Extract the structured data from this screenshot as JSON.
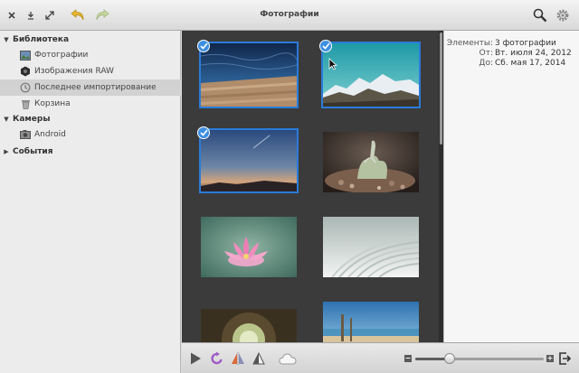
{
  "window": {
    "title": "Фотографии"
  },
  "sidebar": {
    "library": {
      "label": "Библиотека",
      "items": [
        {
          "label": "Фотографии"
        },
        {
          "label": "Изображения RAW"
        },
        {
          "label": "Последнее импортирование"
        },
        {
          "label": "Корзина"
        }
      ]
    },
    "cameras": {
      "label": "Камеры",
      "items": [
        {
          "label": "Android"
        }
      ]
    },
    "events": {
      "label": "События"
    }
  },
  "info": {
    "items_label": "Элементы:",
    "items_value": "3 фотографии",
    "from_label": "От:",
    "from_value": "Вт. июля 24, 2012",
    "to_label": "До:",
    "to_value": "Сб. мая 17, 2014"
  },
  "colors": {
    "accent": "#2b7bd9",
    "check": "#3d8fe0",
    "grid_bg": "#3b3b3b"
  },
  "zoom": {
    "value": 0.27
  }
}
